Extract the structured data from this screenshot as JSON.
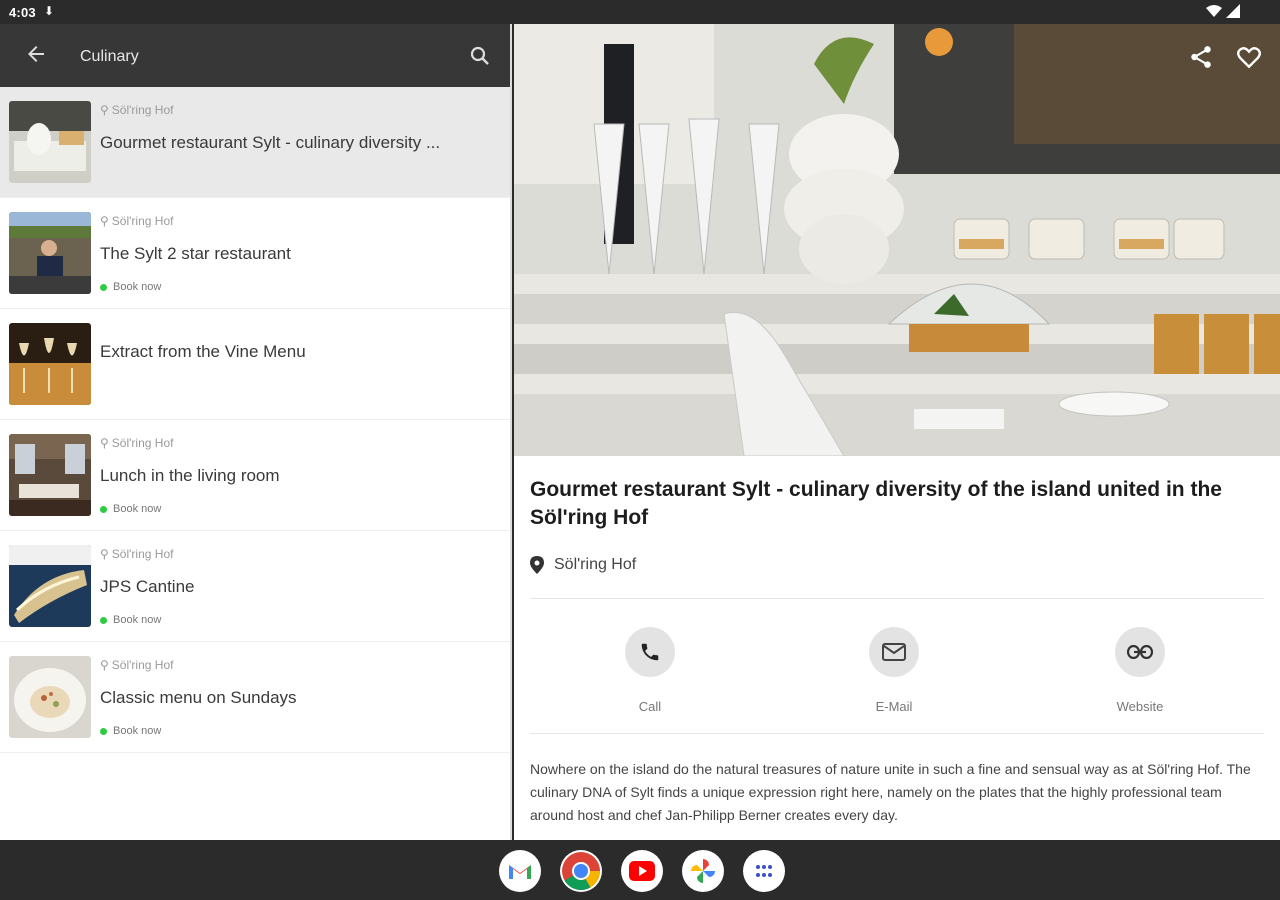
{
  "status": {
    "time": "4:03"
  },
  "toolbar": {
    "title": "Culinary"
  },
  "list": [
    {
      "location": "Söl'ring Hof",
      "title": "Gourmet restaurant Sylt - culinary diversity ...",
      "book": ""
    },
    {
      "location": "Söl'ring Hof",
      "title": "The Sylt 2 star restaurant",
      "book": "Book now"
    },
    {
      "location": "",
      "title": "Extract from the Vine Menu",
      "book": ""
    },
    {
      "location": "Söl'ring Hof",
      "title": "Lunch in the living room",
      "book": "Book now"
    },
    {
      "location": "Söl'ring Hof",
      "title": "JPS Cantine",
      "book": "Book now"
    },
    {
      "location": "Söl'ring Hof",
      "title": "Classic menu on Sundays",
      "book": "Book now"
    }
  ],
  "detail": {
    "title": "Gourmet restaurant Sylt - culinary diversity of the island united in the Söl'ring Hof",
    "location": "Söl'ring Hof",
    "actions": {
      "call": "Call",
      "email": "E-Mail",
      "website": "Website"
    },
    "description": "Nowhere on the island do the natural treasures of nature unite in such a fine and sensual way as at Söl'ring Hof. The culinary DNA of Sylt finds a unique expression right here, namely on the plates that the highly professional team around host and chef Jan-Philipp Berner creates every day."
  },
  "colors": {
    "accent_green": "#2ecc40",
    "toolbar": "#373737",
    "selected_row": "#e9e9e9"
  }
}
